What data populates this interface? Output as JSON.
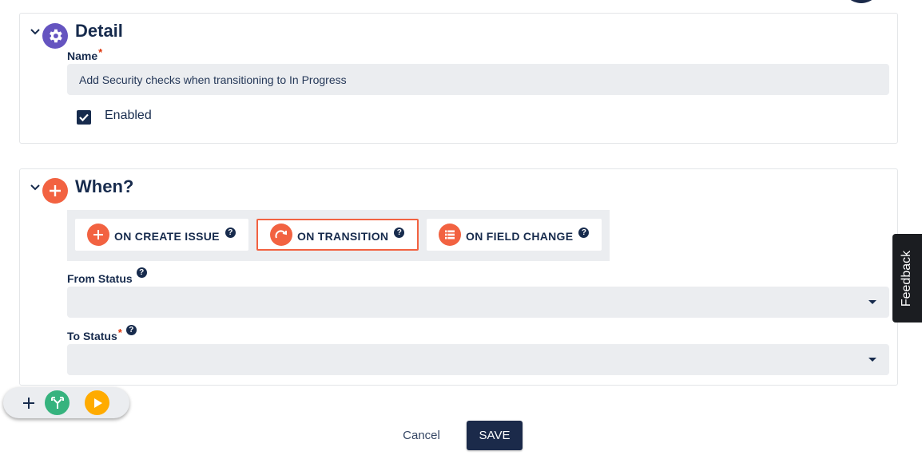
{
  "detail": {
    "title": "Detail",
    "name_label": "Name",
    "required_mark": "*",
    "name_value": "Add Security checks when transitioning to In Progress",
    "enabled_label": "Enabled",
    "enabled_checked": true
  },
  "when": {
    "title": "When?",
    "triggers": [
      {
        "label": "ON CREATE ISSUE",
        "icon": "plus-icon",
        "active": false
      },
      {
        "label": "ON TRANSITION",
        "icon": "transition-arrow-icon",
        "active": true
      },
      {
        "label": "ON FIELD CHANGE",
        "icon": "list-icon",
        "active": false
      }
    ],
    "help_glyph": "?",
    "from_status_label": "From Status",
    "to_status_label": "To Status",
    "required_mark": "*"
  },
  "actions": {
    "cancel_label": "Cancel",
    "save_label": "SAVE"
  },
  "feedback_label": "Feedback",
  "colors": {
    "accent_orange": "#f26241",
    "navy": "#1b2a4a",
    "detail_icon_purple": "#6554c0",
    "branch_green": "#36b37e",
    "play_yellow": "#ffab00",
    "field_bg": "#ebedf0"
  }
}
